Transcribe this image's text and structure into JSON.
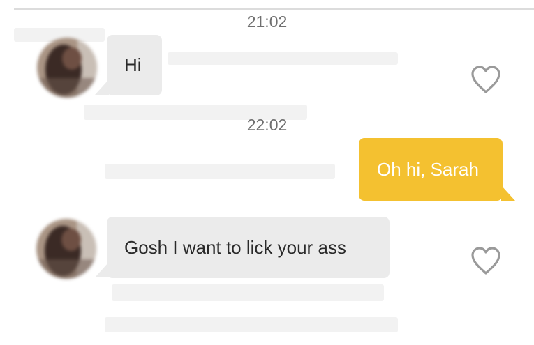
{
  "colors": {
    "incoming_bubble": "#ebebeb",
    "outgoing_bubble": "#f4c130",
    "timestamp_text": "#6f6f6f",
    "heart_outline": "#9a9a9a"
  },
  "messages": [
    {
      "time": "21:02",
      "direction": "incoming",
      "text": "Hi",
      "avatar": "contact-photo",
      "like_icon": "heart-outline-icon"
    },
    {
      "time": "22:02",
      "direction": "outgoing",
      "text": "Oh hi, Sarah"
    },
    {
      "direction": "incoming",
      "text": "Gosh I want to lick your ass",
      "avatar": "contact-photo",
      "like_icon": "heart-outline-icon"
    }
  ]
}
